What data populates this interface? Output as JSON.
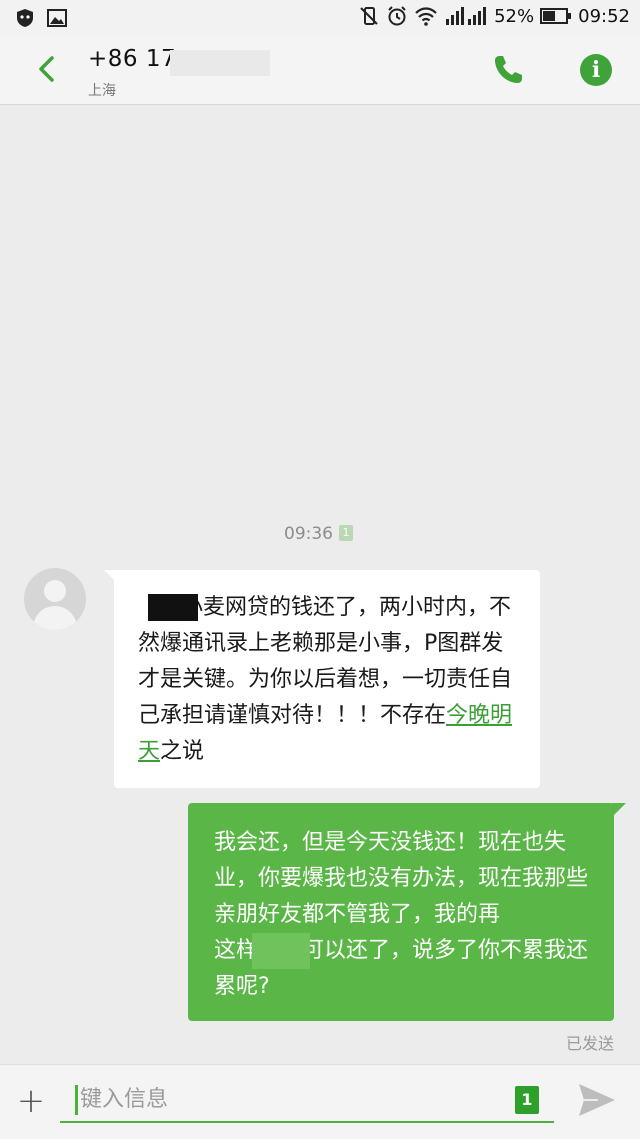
{
  "status_bar": {
    "battery_percent": "52%",
    "time": "09:52",
    "icons": [
      "shield-icon",
      "image-icon",
      "mute-vibrate-icon",
      "alarm-icon",
      "wifi-icon",
      "signal-icon",
      "battery-icon"
    ]
  },
  "header": {
    "contact_number": "+86 17",
    "location": "上海",
    "back_icon": "chevron-left-icon",
    "call_icon": "phone-icon",
    "info_icon": "info-icon",
    "info_label": "i",
    "accent_color": "#3fa33a"
  },
  "conversation": {
    "timestamp": "09:36",
    "sim_label_small": "1",
    "incoming": {
      "text_before_link": "   把小麦网贷的钱还了，两小时内，不然爆通讯录上老赖那是小事，P图群发才是关键。为你以后着想，一切责任自己承担请谨慎对待！！！不存在",
      "link_text": "今晚明天",
      "text_after_link": "之说"
    },
    "outgoing": {
      "text": "我会还，但是今天没钱还！现在也失业，你要爆我也没有办法，现在我那些亲朋好友都不管我了，我的再",
      "text_after_redaction": "这样子就可以还了，说多了你不累我还累呢?",
      "status": "已发送",
      "bubble_color": "#5ab646"
    }
  },
  "composer": {
    "placeholder": "键入信息",
    "sim_label": "1",
    "add_icon": "plus-icon",
    "send_icon": "send-icon"
  }
}
